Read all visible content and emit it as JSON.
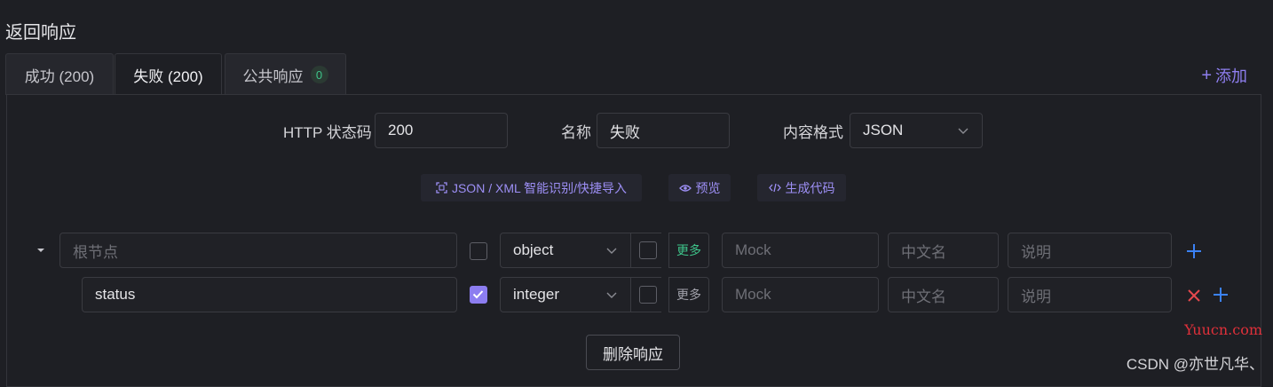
{
  "section_title": "返回响应",
  "tabs": [
    {
      "label": "成功 (200)",
      "active": false
    },
    {
      "label": "失败 (200)",
      "active": true
    },
    {
      "label": "公共响应",
      "badge": "0",
      "active": false
    }
  ],
  "add_link": {
    "icon": "plus-icon",
    "label": "添加"
  },
  "form": {
    "status_code_label": "HTTP 状态码",
    "status_code_value": "200",
    "name_label": "名称",
    "name_value": "失败",
    "content_format_label": "内容格式",
    "content_format_value": "JSON"
  },
  "tools": {
    "import_label": "JSON / XML 智能识别/快捷导入",
    "preview_label": "预览",
    "codegen_label": "生成代码"
  },
  "rows": [
    {
      "name_placeholder": "根节点",
      "name_value": "",
      "required": false,
      "type": "object",
      "more_label": "更多",
      "mock_placeholder": "Mock",
      "cn_name_placeholder": "中文名",
      "desc_placeholder": "说明"
    },
    {
      "name_placeholder": "",
      "name_value": "status",
      "required": true,
      "type": "integer",
      "more_label": "更多",
      "mock_placeholder": "Mock",
      "cn_name_placeholder": "中文名",
      "desc_placeholder": "说明"
    }
  ],
  "delete_response_label": "删除响应",
  "watermarks": {
    "site": "Yuucn.com",
    "author": "CSDN @亦世凡华、"
  },
  "colors": {
    "accent": "#8c7df0",
    "success": "#3ec48a",
    "danger": "#e5484d",
    "link_blue": "#3b82f6"
  }
}
